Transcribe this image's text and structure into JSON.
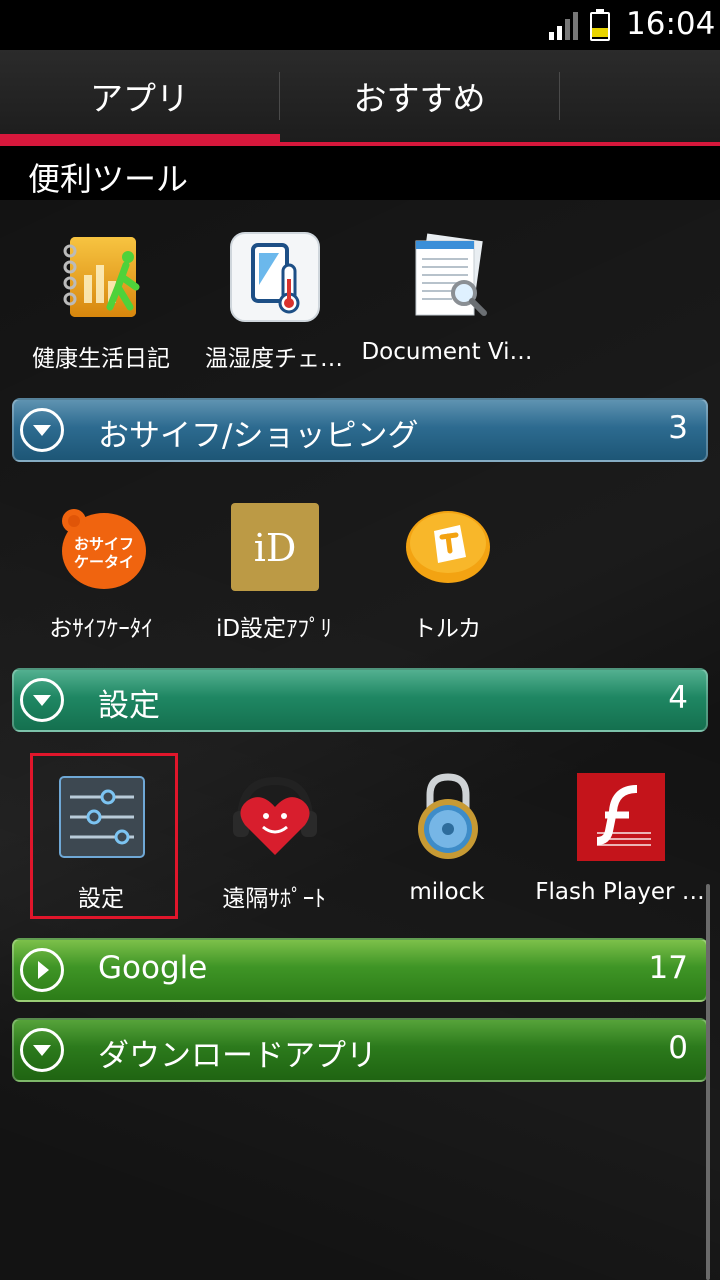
{
  "status_bar": {
    "time": "16:04"
  },
  "tabs": [
    {
      "label": "アプリ",
      "selected": true
    },
    {
      "label": "おすすめ",
      "selected": false
    }
  ],
  "section_tools": {
    "title": "便利ツール",
    "apps": [
      {
        "label": "健康生活日記",
        "icon": "health-diary-icon"
      },
      {
        "label": "温湿度チェ…",
        "icon": "thermometer-icon"
      },
      {
        "label": "Document Vi…",
        "icon": "document-viewer-icon"
      }
    ]
  },
  "category_osaifu": {
    "title": "おサイフ/ショッピング",
    "count": "3",
    "expanded": true,
    "apps": [
      {
        "label": "おｻｲﾌｹｰﾀｲ",
        "icon": "osaifu-keitai-icon",
        "icon_text": "おサイフ ケータイ"
      },
      {
        "label": "iD設定ｱﾌﾟﾘ",
        "icon": "id-app-icon",
        "icon_text": "iD"
      },
      {
        "label": "トルカ",
        "icon": "toruca-icon"
      }
    ]
  },
  "category_settings": {
    "title": "設定",
    "count": "4",
    "expanded": true,
    "apps": [
      {
        "label": "設定",
        "icon": "settings-icon"
      },
      {
        "label": "遠隔ｻﾎﾟｰﾄ",
        "icon": "remote-support-icon"
      },
      {
        "label": "milock",
        "icon": "milock-padlock-icon"
      },
      {
        "label": "Flash Player …",
        "icon": "flash-player-icon"
      }
    ]
  },
  "category_google": {
    "title": "Google",
    "count": "17",
    "expanded": false
  },
  "category_download": {
    "title": "ダウンロードアプリ",
    "count": "0",
    "expanded": true
  },
  "colors": {
    "accent_red": "#d7183c",
    "highlight_red": "#e0162b",
    "osaifu_bar": "#2d6b90",
    "settings_bar": "#1f8763",
    "google_bar": "#3f9526"
  }
}
